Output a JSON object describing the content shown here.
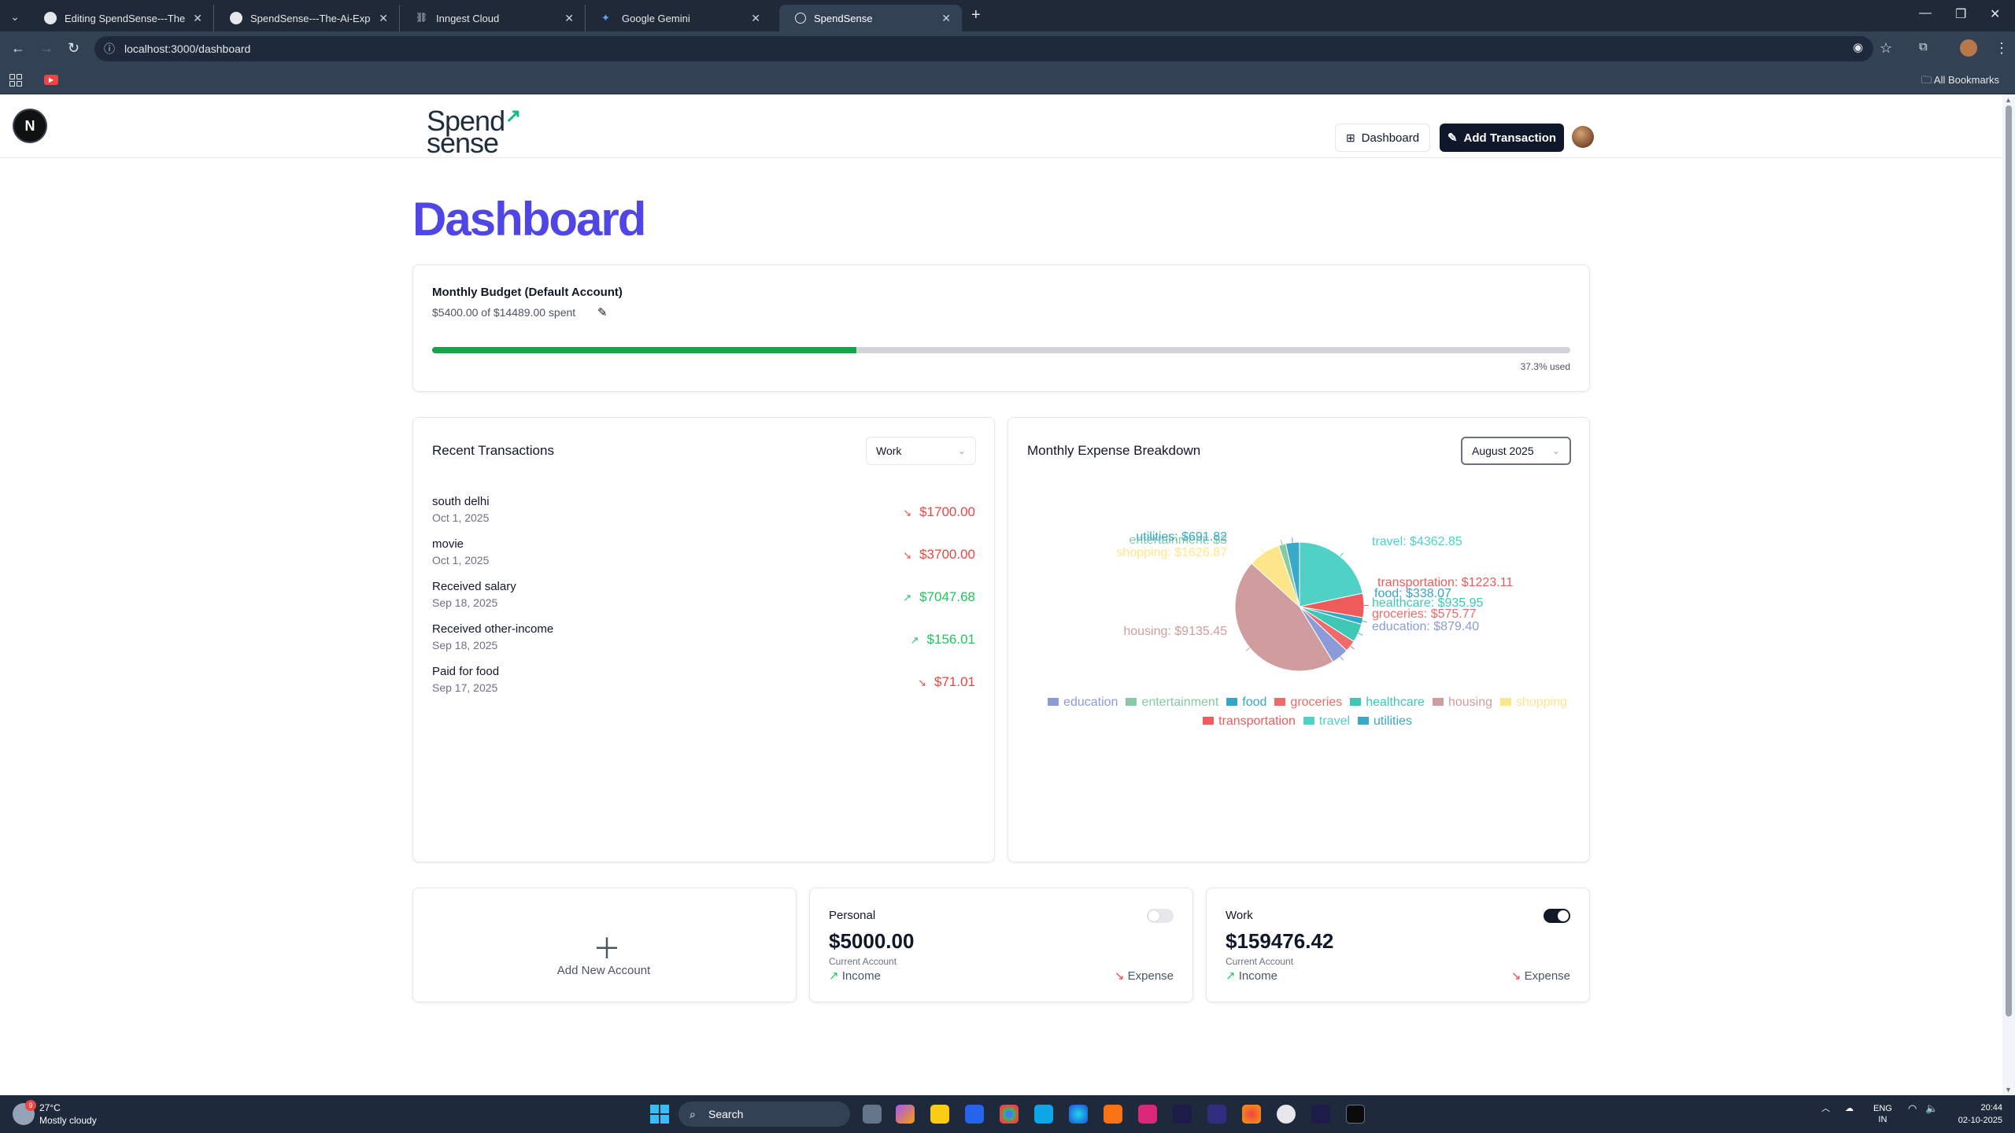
{
  "browser": {
    "tabs": [
      {
        "label": "Editing SpendSense---The-Ai-E"
      },
      {
        "label": "SpendSense---The-Ai-Expense"
      },
      {
        "label": "Inngest Cloud"
      },
      {
        "label": "Google Gemini"
      },
      {
        "label": "SpendSense"
      }
    ],
    "url": "localhost:3000/dashboard",
    "all_bookmarks": "All Bookmarks"
  },
  "header": {
    "brand_line1": "Spend",
    "brand_line2": "sense",
    "dashboard_label": "Dashboard",
    "add_transaction_label": "Add Transaction"
  },
  "page_title": "Dashboard",
  "budget": {
    "title": "Monthly Budget (Default Account)",
    "spent_text": "$5400.00 of $14489.00 spent",
    "used_fraction": 0.373,
    "used_label": "37.3% used"
  },
  "recent": {
    "title": "Recent Transactions",
    "account_selected": "Work",
    "items": [
      {
        "name": "south delhi",
        "date": "Oct 1, 2025",
        "amount": "$1700.00",
        "type": "expense"
      },
      {
        "name": "movie",
        "date": "Oct 1, 2025",
        "amount": "$3700.00",
        "type": "expense"
      },
      {
        "name": "Received salary",
        "date": "Sep 18, 2025",
        "amount": "$7047.68",
        "type": "income"
      },
      {
        "name": "Received other-income",
        "date": "Sep 18, 2025",
        "amount": "$156.01",
        "type": "income"
      },
      {
        "name": "Paid for food",
        "date": "Sep 17, 2025",
        "amount": "$71.01",
        "type": "expense"
      }
    ]
  },
  "breakdown": {
    "title": "Monthly Expense Breakdown",
    "month_selected": "August 2025"
  },
  "chart_data": {
    "type": "pie",
    "categories": [
      "education",
      "entertainment",
      "food",
      "groceries",
      "healthcare",
      "housing",
      "shopping",
      "transportation",
      "travel",
      "utilities"
    ],
    "values": [
      879.4,
      360.0,
      338.07,
      575.77,
      935.95,
      9135.45,
      1626.87,
      1223.11,
      4362.85,
      691.82
    ],
    "slice_labels": [
      "education: $879.40",
      "entertainment: $3",
      "food: $338.07",
      "groceries: $575.77",
      "healthcare: $935.95",
      "housing: $9135.45",
      "shopping: $1626.87",
      "transportation: $1223.11",
      "travel: $4362.85",
      "utilities: $691.82"
    ],
    "colors": {
      "education": "#8b9bd8",
      "entertainment": "#86c9a3",
      "food": "#35a7c6",
      "groceries": "#f06a6a",
      "healthcare": "#3ec7b5",
      "housing": "#cf9d9d",
      "shopping": "#fde68a",
      "transportation": "#ef5a5a",
      "travel": "#4fd1c5",
      "utilities": "#38a9c9"
    },
    "legend_position": "bottom"
  },
  "accounts": {
    "add_label": "Add New Account",
    "items": [
      {
        "name": "Personal",
        "balance": "$5000.00",
        "type_label": "Current Account",
        "income_label": "Income",
        "expense_label": "Expense",
        "is_default": false
      },
      {
        "name": "Work",
        "balance": "$159476.42",
        "type_label": "Current Account",
        "income_label": "Income",
        "expense_label": "Expense",
        "is_default": true
      }
    ]
  },
  "taskbar": {
    "temperature": "27°C",
    "weather": "Mostly cloudy",
    "weather_badge": "9",
    "search_label": "Search",
    "lang_top": "ENG",
    "lang_bottom": "IN",
    "time": "20:44",
    "date": "02-10-2025"
  }
}
